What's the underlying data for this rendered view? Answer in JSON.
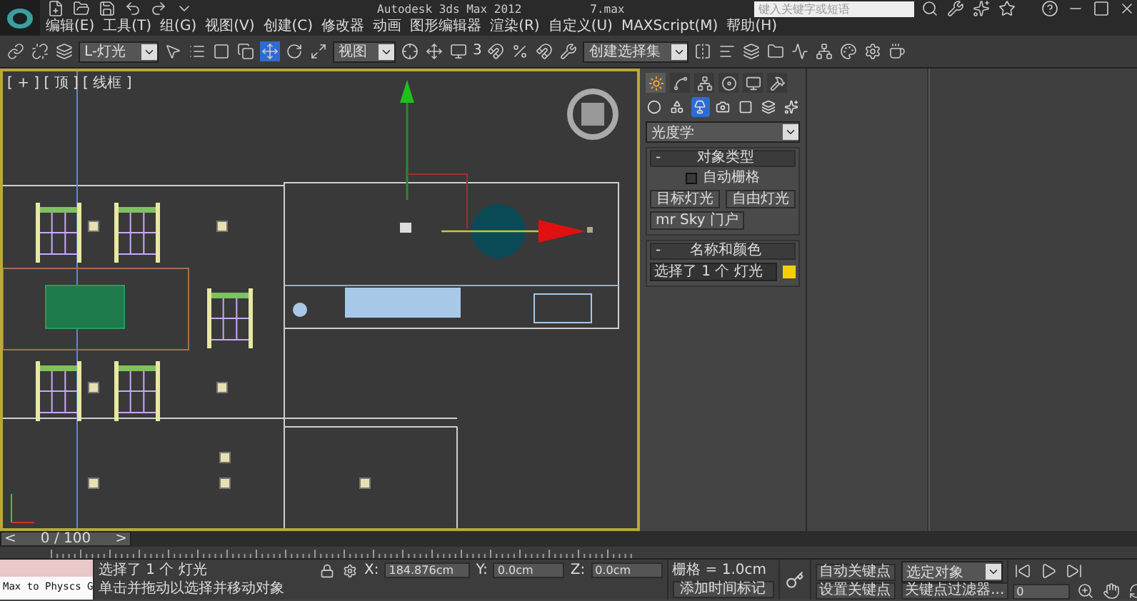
{
  "window": {
    "title": "Autodesk 3ds Max  2012",
    "file": "7.max"
  },
  "search": {
    "placeholder": "键入关键字或短语"
  },
  "menu": [
    "编辑(E)",
    "工具(T)",
    "组(G)",
    "视图(V)",
    "创建(C)",
    "修改器",
    "动画",
    "图形编辑器",
    "渲染(R)",
    "自定义(U)",
    "MAXScript(M)",
    "帮助(H)"
  ],
  "toolbar": {
    "selection_filter": "L-灯光",
    "reference_coord": "视图",
    "snap_label": "3",
    "named_selection": "创建选择集",
    "move_tool": {
      "selected": true
    }
  },
  "viewport": {
    "label": "[ + ] [ 顶 ] [ 线框 ]"
  },
  "command_panel": {
    "tabs": [
      {
        "selected": true
      },
      {
        "selected": false
      },
      {
        "selected": false
      },
      {
        "selected": false
      },
      {
        "selected": false
      },
      {
        "selected": false
      }
    ],
    "categories": [
      {
        "selected": false
      },
      {
        "selected": false
      },
      {
        "selected": true
      },
      {
        "selected": false
      },
      {
        "selected": false
      },
      {
        "selected": false
      },
      {
        "selected": false
      }
    ],
    "type_dropdown": "光度学",
    "object_type": {
      "sign": "-",
      "title": "对象类型",
      "auto_grid": {
        "label": "自动栅格",
        "checked": false
      },
      "buttons": [
        "目标灯光",
        "自由灯光",
        "mr Sky 门户"
      ]
    },
    "name_color": {
      "sign": "-",
      "title": "名称和颜色",
      "name": "选择了 1 个 灯光",
      "color": "#f5d000"
    }
  },
  "timeline": {
    "prev": "<",
    "frame": "0 / 100",
    "next": ">",
    "level": 0
  },
  "status": {
    "listener": "Max to Physcs G",
    "selection": "选择了 1 个 灯光",
    "prompt": "单击并拖动以选择并移动对象",
    "coords": [
      {
        "label": "X:",
        "value": "184.876cm"
      },
      {
        "label": "Y:",
        "value": "0.0cm"
      },
      {
        "label": "Z:",
        "value": "0.0cm"
      }
    ],
    "grid": "栅格 = 1.0cm",
    "add_time_tag": "添加时间标记",
    "auto_key": "自动关键点",
    "set_key": "设置关键点",
    "key_mode": "选定对象",
    "key_filters": "关键点过滤器...",
    "current_frame": "0"
  }
}
